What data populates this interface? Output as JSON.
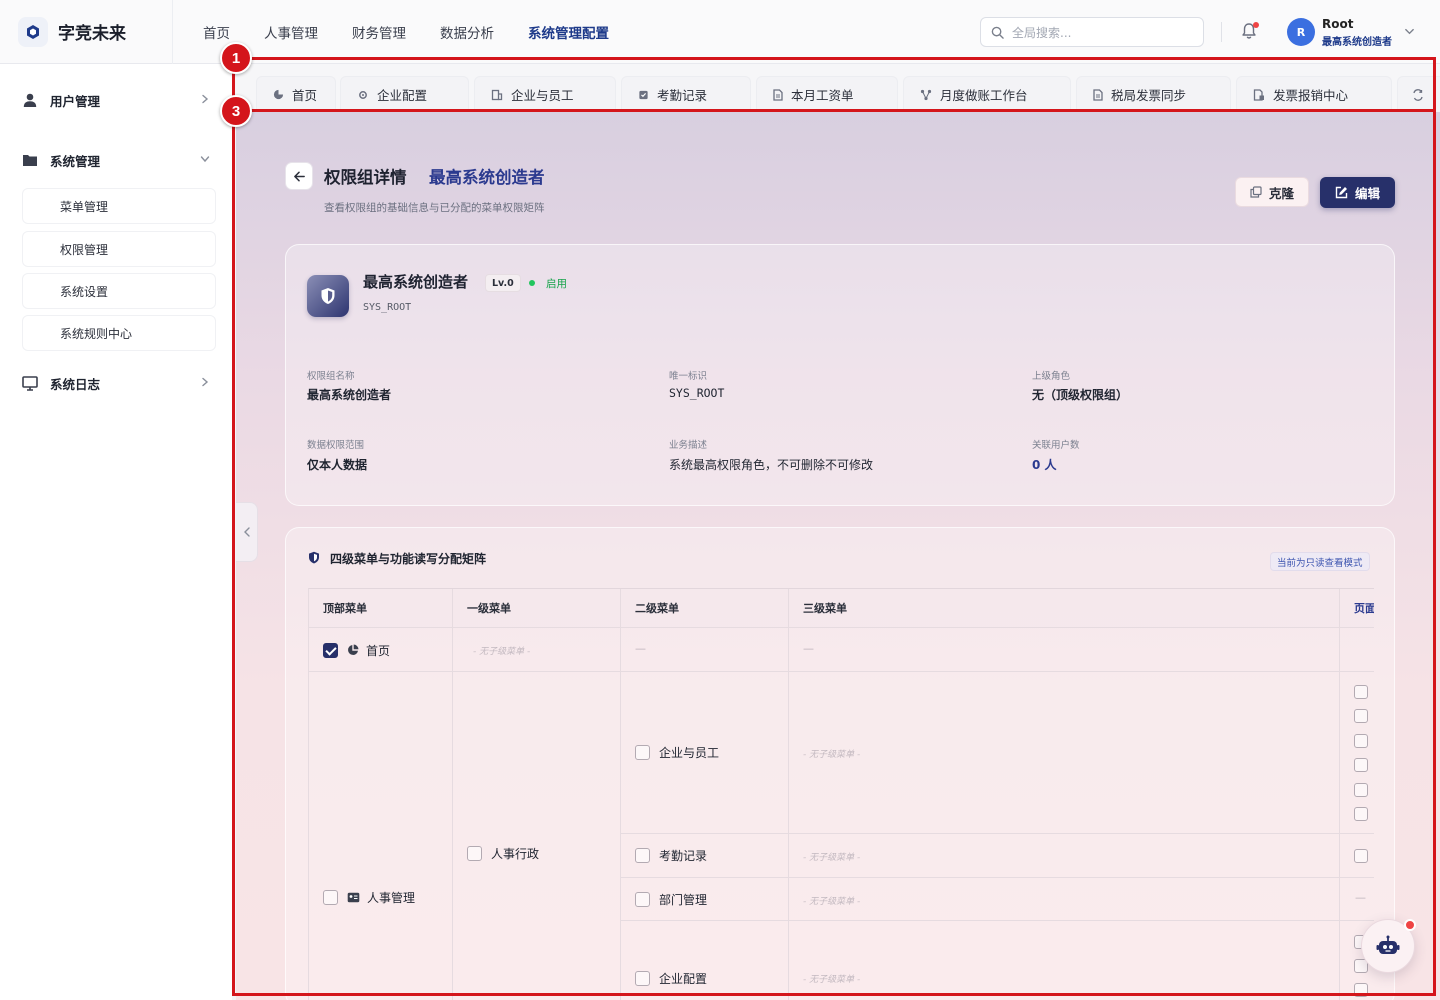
{
  "header": {
    "brand": "字竞未来",
    "nav": [
      "首页",
      "人事管理",
      "财务管理",
      "数据分析",
      "系统管理配置"
    ],
    "search_placeholder": "全局搜索...",
    "user": {
      "initial": "R",
      "name": "Root",
      "role": "最高系统创造者"
    }
  },
  "sidebar": {
    "groups": [
      {
        "label": "用户管理",
        "icon": "user-icon"
      },
      {
        "label": "系统管理",
        "icon": "folder-icon"
      },
      {
        "label": "系统日志",
        "icon": "monitor-icon"
      }
    ],
    "sub_items": [
      "菜单管理",
      "权限管理",
      "系统设置",
      "系统规则中心"
    ]
  },
  "tabs": [
    "首页",
    "企业配置",
    "企业与员工",
    "考勤记录",
    "本月工资单",
    "月度做账工作台",
    "税局发票同步",
    "发票报销中心"
  ],
  "page": {
    "title": "权限组详情",
    "title_accent": "最高系统创造者",
    "subtitle": "查看权限组的基础信息与已分配的菜单权限矩阵",
    "clone_label": "克隆",
    "edit_label": "编辑"
  },
  "group": {
    "name": "最高系统创造者",
    "level": "Lv.0",
    "status": "启用",
    "code": "SYS_ROOT",
    "fields": [
      {
        "label": "权限组名称",
        "value": "最高系统创造者"
      },
      {
        "label": "唯一标识",
        "value": "SYS_ROOT"
      },
      {
        "label": "上级角色",
        "value": "无（顶级权限组）"
      },
      {
        "label": "数据权限范围",
        "value": "仅本人数据"
      },
      {
        "label": "业务描述",
        "value": "系统最高权限角色，不可删除不可修改"
      },
      {
        "label": "关联用户数",
        "value": "0 人"
      }
    ]
  },
  "matrix": {
    "title": "四级菜单与功能读写分配矩阵",
    "readonly_badge": "当前为只读查看模式",
    "columns": [
      "顶部菜单",
      "一级菜单",
      "二级菜单",
      "三级菜单",
      "页面"
    ],
    "no_child": "- 无子级菜单 -",
    "dash": "—",
    "rows": {
      "home": "首页",
      "hr": "人事管理",
      "hr_admin": "人事行政",
      "l2": [
        "企业与员工",
        "考勤记录",
        "部门管理",
        "企业配置"
      ]
    }
  },
  "annotations": [
    "1",
    "3"
  ]
}
